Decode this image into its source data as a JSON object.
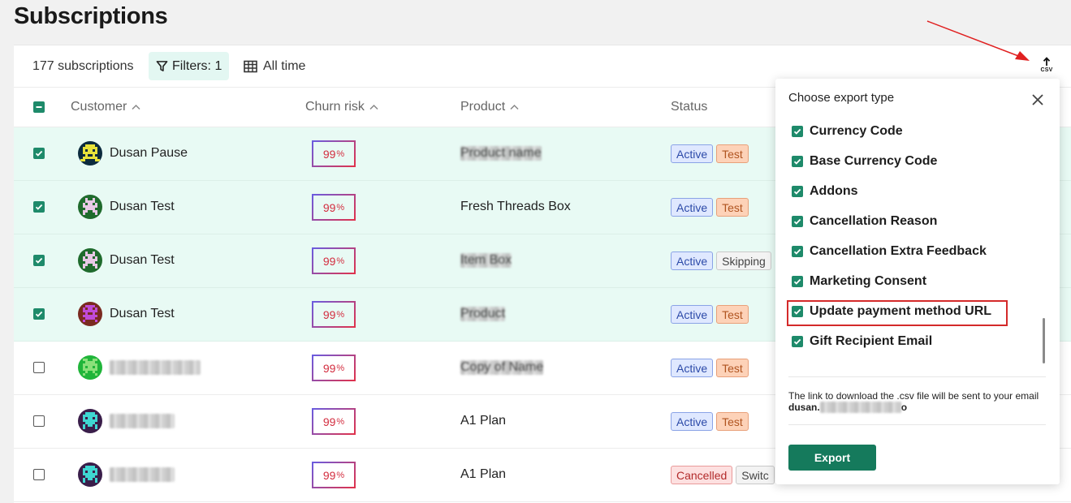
{
  "page": {
    "title": "Subscriptions"
  },
  "toolbar": {
    "count_label": "177 subscriptions",
    "filters_label": "Filters: 1",
    "date_label": "All time",
    "export_icon_text": "CSV"
  },
  "table": {
    "headers": {
      "customer": "Customer",
      "churn": "Churn risk",
      "product": "Product",
      "status": "Status"
    },
    "rows": [
      {
        "selected": true,
        "customer": "Dusan Pause",
        "customer_blurred": false,
        "churn": "99",
        "churn_unit": "%",
        "product": "Product name",
        "product_blurred": true,
        "badges": [
          {
            "label": "Active",
            "kind": "active"
          },
          {
            "label": "Test",
            "kind": "test"
          }
        ],
        "avatar": "avatar-1"
      },
      {
        "selected": true,
        "customer": "Dusan Test",
        "customer_blurred": false,
        "churn": "99",
        "churn_unit": "%",
        "product": "Fresh Threads Box",
        "product_blurred": false,
        "badges": [
          {
            "label": "Active",
            "kind": "active"
          },
          {
            "label": "Test",
            "kind": "test"
          }
        ],
        "avatar": "avatar-2"
      },
      {
        "selected": true,
        "customer": "Dusan Test",
        "customer_blurred": false,
        "churn": "99",
        "churn_unit": "%",
        "product": "Item Box",
        "product_blurred": true,
        "badges": [
          {
            "label": "Active",
            "kind": "active"
          },
          {
            "label": "Skipping",
            "kind": "skip"
          }
        ],
        "avatar": "avatar-3"
      },
      {
        "selected": true,
        "customer": "Dusan Test",
        "customer_blurred": false,
        "churn": "99",
        "churn_unit": "%",
        "product": "Product",
        "product_blurred": true,
        "badges": [
          {
            "label": "Active",
            "kind": "active"
          },
          {
            "label": "Test",
            "kind": "test"
          }
        ],
        "avatar": "avatar-4"
      },
      {
        "selected": false,
        "customer": "Name Surname",
        "customer_blurred": true,
        "churn": "99",
        "churn_unit": "%",
        "product": "Copy of Name",
        "product_blurred": true,
        "badges": [
          {
            "label": "Active",
            "kind": "active"
          },
          {
            "label": "Test",
            "kind": "test"
          }
        ],
        "avatar": "avatar-5"
      },
      {
        "selected": false,
        "customer": "Dusan Test",
        "customer_blurred": true,
        "churn": "99",
        "churn_unit": "%",
        "product": "A1 Plan",
        "product_blurred": false,
        "badges": [
          {
            "label": "Active",
            "kind": "active"
          },
          {
            "label": "Test",
            "kind": "test"
          }
        ],
        "avatar": "avatar-6"
      },
      {
        "selected": false,
        "customer": "Dusan Test",
        "customer_blurred": true,
        "churn": "99",
        "churn_unit": "%",
        "product": "A1 Plan",
        "product_blurred": false,
        "badges": [
          {
            "label": "Cancelled",
            "kind": "cancel"
          },
          {
            "label": "Switc",
            "kind": "switch"
          }
        ],
        "avatar": "avatar-7"
      }
    ]
  },
  "export_popover": {
    "title": "Choose export type",
    "items": [
      "Currency Code",
      "Base Currency Code",
      "Addons",
      "Cancellation Reason",
      "Cancellation Extra Feedback",
      "Marketing Consent",
      "Update payment method URL",
      "Gift Recipient Email"
    ],
    "highlighted_item": "Update payment method URL",
    "note_text": "The link to download the .csv file will be sent to your email",
    "note_email": "dusan.",
    "note_email_end": "o",
    "export_label": "Export"
  },
  "colors": {
    "accent": "#1e8a6a",
    "export_button": "#157a5c",
    "selected_row": "#e8faf4",
    "annotation_red": "#d42a2a"
  }
}
